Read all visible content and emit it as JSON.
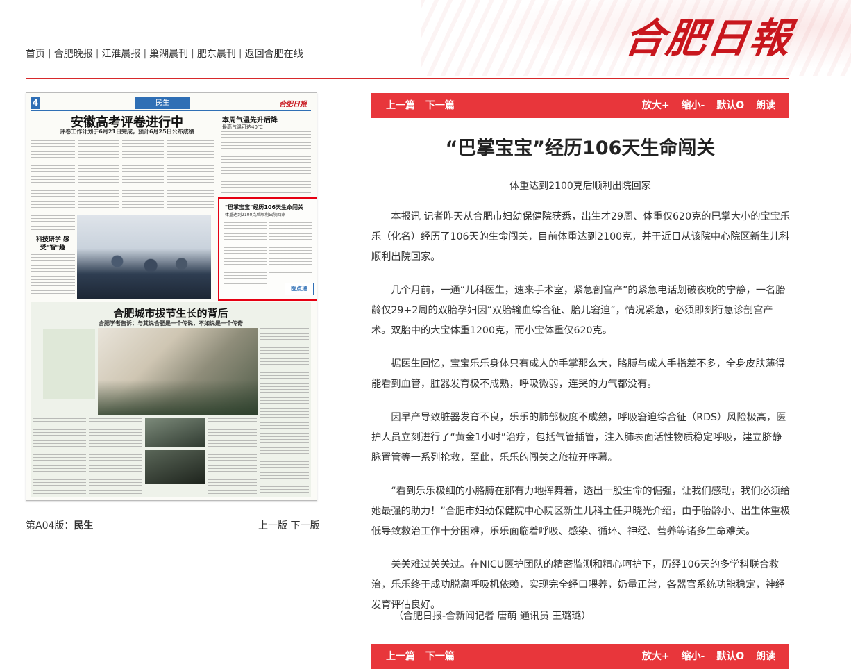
{
  "header": {
    "logo": "合肥日報",
    "nav": [
      {
        "label": "首页"
      },
      {
        "label": "合肥晚报"
      },
      {
        "label": "江淮晨报"
      },
      {
        "label": "巢湖晨刊"
      },
      {
        "label": "肥东晨刊"
      },
      {
        "label": "返回合肥在线"
      }
    ],
    "nav_separator": "|"
  },
  "newspaper": {
    "page_no": "4",
    "section_tab": "民生",
    "mini_logo": "合肥日报",
    "headline1": "安徽高考评卷进行中",
    "sub1": "评卷工作计划于6月21日完成，预计6月25日公布成绩",
    "headline_right": "本周气温先升后降",
    "headline_right_sub": "最高气温可达40℃",
    "kicker": "科技研学 感受\"智\"趣",
    "highlight_title": "\"巴掌宝宝\"经历106天生命闯关",
    "highlight_sub": "体重达到2100克后顺利出院回家",
    "highlight_badge": "医点通",
    "headline2": "合肥城市拔节生长的背后",
    "sub2": "合肥学者告诉：与其说合肥是一个传说，不如说是一个传奇",
    "caption_prefix": "第A04版：",
    "caption_section": "民生",
    "prev_page": "上一版",
    "next_page": "下一版"
  },
  "toolbar": {
    "prev": "上一篇",
    "next": "下一篇",
    "zoom_in": "放大+",
    "zoom_out": "缩小-",
    "default": "默认O",
    "read": "朗读"
  },
  "article": {
    "title": "“巴掌宝宝”经历106天生命闯关",
    "subtitle": "体重达到2100克后顺利出院回家",
    "paragraphs": [
      "本报讯 记者昨天从合肥市妇幼保健院获悉，出生才29周、体重仅620克的巴掌大小的宝宝乐乐（化名）经历了106天的生命闯关，目前体重达到2100克，并于近日从该院中心院区新生儿科顺利出院回家。",
      "几个月前，一通“儿科医生，速来手术室，紧急剖宫产”的紧急电话划破夜晚的宁静，一名胎龄仅29+2周的双胎孕妇因“双胎输血综合征、胎儿窘迫”，情况紧急，必须即刻行急诊剖宫产术。双胎中的大宝体重1200克，而小宝体重仅620克。",
      "据医生回忆，宝宝乐乐身体只有成人的手掌那么大，胳膊与成人手指差不多，全身皮肤薄得能看到血管，脏器发育极不成熟，呼吸微弱，连哭的力气都没有。",
      "因早产导致脏器发育不良，乐乐的肺部极度不成熟，呼吸窘迫综合征（RDS）风险极高，医护人员立刻进行了“黄金1小时”治疗，包括气管插管，注入肺表面活性物质稳定呼吸，建立脐静脉置管等一系列抢救，至此，乐乐的闯关之旅拉开序幕。",
      "“看到乐乐极细的小胳膊在那有力地挥舞着，透出一股生命的倔强，让我们感动，我们必须给她最强的助力！”合肥市妇幼保健院中心院区新生儿科主任尹晓光介绍，由于胎龄小、出生体重极低导致救治工作十分困难，乐乐面临着呼吸、感染、循环、神经、营养等诸多生命难关。",
      "关关难过关关过。在NICU医护团队的精密监测和精心呵护下，历经106天的多学科联合救治，乐乐终于成功脱离呼吸机依赖，实现完全经口喂养，奶量正常，各器官系统功能稳定，神经发育评估良好。"
    ],
    "byline": "（合肥日报-合新闻记者 唐萌 通讯员 王璐璐）"
  },
  "colors": {
    "accent": "#e8363b",
    "logo": "#c8161d",
    "paper_blue": "#2f6fb5",
    "highlight_border": "#e60012"
  }
}
